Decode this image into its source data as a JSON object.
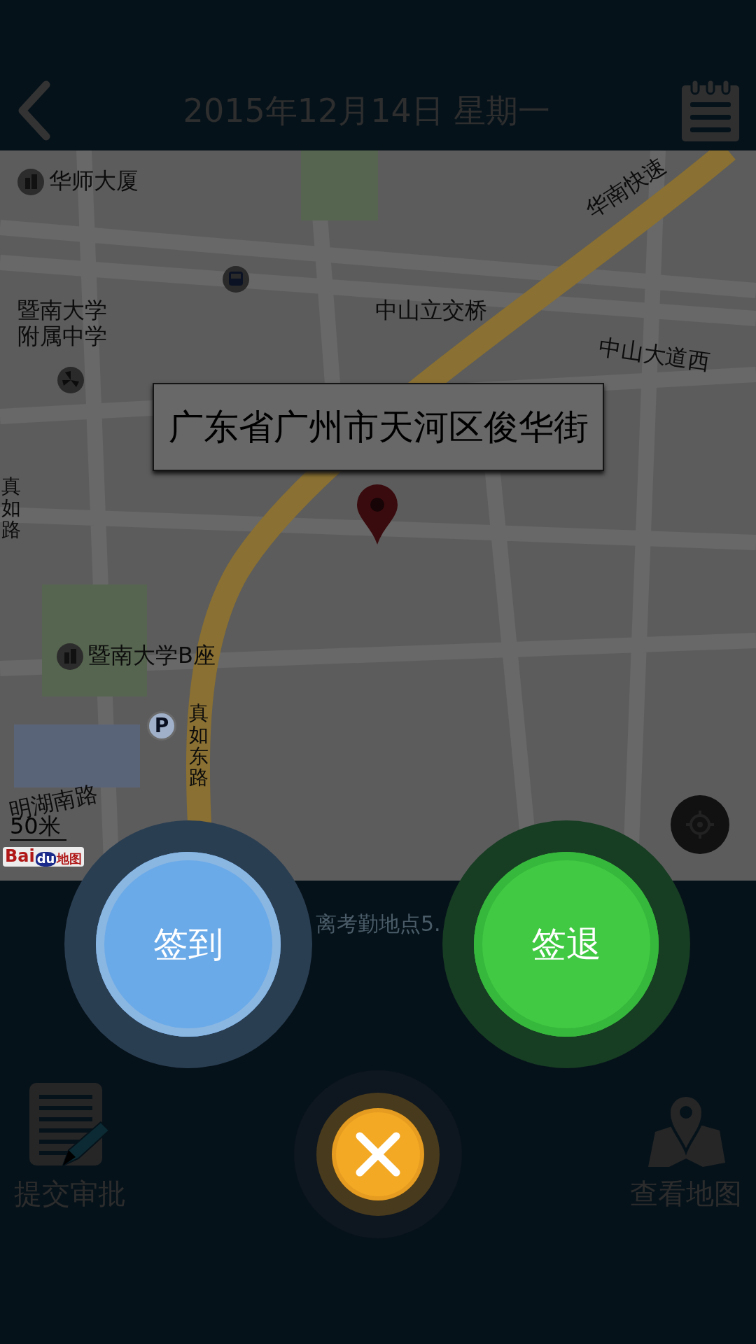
{
  "header": {
    "title": "2015年12月14日 星期一"
  },
  "map": {
    "labels": [
      {
        "text": "华师大厦",
        "kind": "building"
      },
      {
        "text": "暨南大学附属中学",
        "kind": "area"
      },
      {
        "text": "中山立交桥",
        "kind": "area"
      },
      {
        "text": "华南快速",
        "kind": "road"
      },
      {
        "text": "中山大道西",
        "kind": "road"
      },
      {
        "text": "真如路",
        "kind": "vroad"
      },
      {
        "text": "暨南大学B座",
        "kind": "building"
      },
      {
        "text": "真如东路",
        "kind": "vroad"
      },
      {
        "text": "明湖南路",
        "kind": "road"
      }
    ],
    "markers": [
      {
        "kind": "bus"
      },
      {
        "kind": "fan"
      },
      {
        "kind": "parking",
        "text": "P"
      }
    ],
    "callout": "广东省广州市天河区俊华街",
    "scale": "50米",
    "logo": [
      "Bai",
      "du",
      "地图"
    ]
  },
  "distance_text": "离考勤地点5.",
  "actions": [
    {
      "label": "提交审批",
      "kind": "approval"
    },
    {
      "label": "查看地图",
      "kind": "map"
    }
  ],
  "popup": {
    "buttons": [
      {
        "label": "签到",
        "kind": "sign_in"
      },
      {
        "label": "签退",
        "kind": "sign_out"
      }
    ]
  }
}
